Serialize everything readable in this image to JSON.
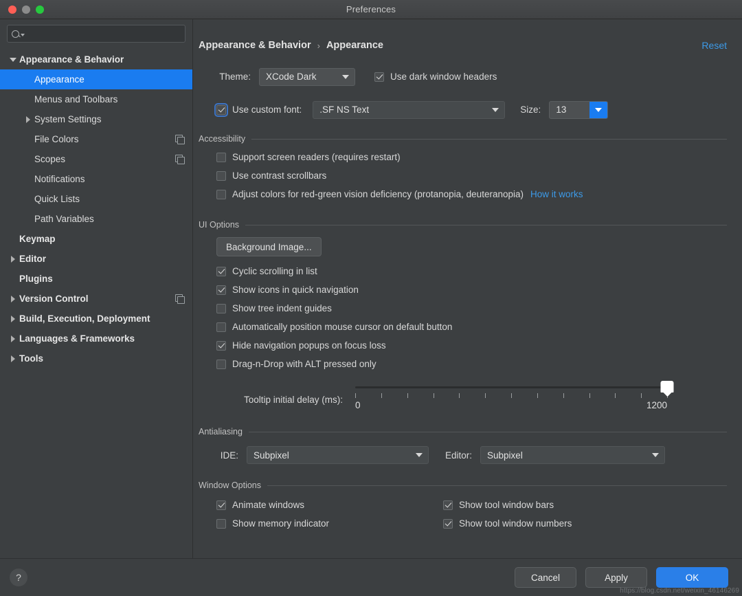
{
  "window": {
    "title": "Preferences",
    "traffic_lights": [
      "close",
      "minimize",
      "zoom"
    ]
  },
  "sidebar": {
    "search": {
      "value": "",
      "placeholder": ""
    },
    "items": [
      {
        "label": "Appearance & Behavior",
        "twisty": "down",
        "bold": true,
        "indent": 0,
        "selected": false,
        "copy": false
      },
      {
        "label": "Appearance",
        "twisty": "none",
        "bold": false,
        "indent": 1,
        "selected": true,
        "copy": false
      },
      {
        "label": "Menus and Toolbars",
        "twisty": "none",
        "bold": false,
        "indent": 1,
        "selected": false,
        "copy": false
      },
      {
        "label": "System Settings",
        "twisty": "right",
        "bold": false,
        "indent": 1,
        "selected": false,
        "copy": false
      },
      {
        "label": "File Colors",
        "twisty": "none",
        "bold": false,
        "indent": 1,
        "selected": false,
        "copy": true
      },
      {
        "label": "Scopes",
        "twisty": "none",
        "bold": false,
        "indent": 1,
        "selected": false,
        "copy": true
      },
      {
        "label": "Notifications",
        "twisty": "none",
        "bold": false,
        "indent": 1,
        "selected": false,
        "copy": false
      },
      {
        "label": "Quick Lists",
        "twisty": "none",
        "bold": false,
        "indent": 1,
        "selected": false,
        "copy": false
      },
      {
        "label": "Path Variables",
        "twisty": "none",
        "bold": false,
        "indent": 1,
        "selected": false,
        "copy": false
      },
      {
        "label": "Keymap",
        "twisty": "none",
        "bold": true,
        "indent": 0,
        "selected": false,
        "copy": false
      },
      {
        "label": "Editor",
        "twisty": "right",
        "bold": true,
        "indent": 0,
        "selected": false,
        "copy": false
      },
      {
        "label": "Plugins",
        "twisty": "none",
        "bold": true,
        "indent": 0,
        "selected": false,
        "copy": false
      },
      {
        "label": "Version Control",
        "twisty": "right",
        "bold": true,
        "indent": 0,
        "selected": false,
        "copy": true
      },
      {
        "label": "Build, Execution, Deployment",
        "twisty": "right",
        "bold": true,
        "indent": 0,
        "selected": false,
        "copy": false
      },
      {
        "label": "Languages & Frameworks",
        "twisty": "right",
        "bold": true,
        "indent": 0,
        "selected": false,
        "copy": false
      },
      {
        "label": "Tools",
        "twisty": "right",
        "bold": true,
        "indent": 0,
        "selected": false,
        "copy": false
      }
    ]
  },
  "breadcrumb": {
    "parent": "Appearance & Behavior",
    "separator": "›",
    "current": "Appearance",
    "reset_label": "Reset"
  },
  "theme_row": {
    "label": "Theme:",
    "value": "XCode Dark",
    "dark_headers": {
      "label": "Use dark window headers",
      "checked": true
    }
  },
  "font_row": {
    "custom_font": {
      "label": "Use custom font:",
      "checked": true,
      "focused": true
    },
    "font_value": ".SF NS Text",
    "size_label": "Size:",
    "size_value": "13"
  },
  "accessibility": {
    "title": "Accessibility",
    "items": [
      {
        "label": "Support screen readers (requires restart)",
        "checked": false,
        "link": null
      },
      {
        "label": "Use contrast scrollbars",
        "checked": false,
        "link": null
      },
      {
        "label": "Adjust colors for red-green vision deficiency (protanopia, deuteranopia)",
        "checked": false,
        "link": "How it works"
      }
    ]
  },
  "ui_options": {
    "title": "UI Options",
    "background_button": "Background Image...",
    "items": [
      {
        "label": "Cyclic scrolling in list",
        "checked": true
      },
      {
        "label": "Show icons in quick navigation",
        "checked": true
      },
      {
        "label": "Show tree indent guides",
        "checked": false
      },
      {
        "label": "Automatically position mouse cursor on default button",
        "checked": false
      },
      {
        "label": "Hide navigation popups on focus loss",
        "checked": true
      },
      {
        "label": "Drag-n-Drop with ALT pressed only",
        "checked": false
      }
    ],
    "slider": {
      "label": "Tooltip initial delay (ms):",
      "min_label": "0",
      "max_label": "1200",
      "min": 0,
      "max": 1200,
      "value": 1200,
      "tick_count": 13
    }
  },
  "antialiasing": {
    "title": "Antialiasing",
    "ide_label": "IDE:",
    "ide_value": "Subpixel",
    "editor_label": "Editor:",
    "editor_value": "Subpixel"
  },
  "window_options": {
    "title": "Window Options",
    "left": [
      {
        "label": "Animate windows",
        "checked": true
      },
      {
        "label": "Show memory indicator",
        "checked": false
      }
    ],
    "right": [
      {
        "label": "Show tool window bars",
        "checked": true
      },
      {
        "label": "Show tool window numbers",
        "checked": true
      }
    ]
  },
  "footer": {
    "help_label": "?",
    "cancel_label": "Cancel",
    "apply_label": "Apply",
    "ok_label": "OK"
  },
  "watermark": "https://blog.csdn.net/weixin_46146269",
  "colors": {
    "accent_blue": "#1a7cf0",
    "link_blue": "#3c9ae8",
    "window_bg": "#3c3f41",
    "selection": "#1a7cf0"
  }
}
